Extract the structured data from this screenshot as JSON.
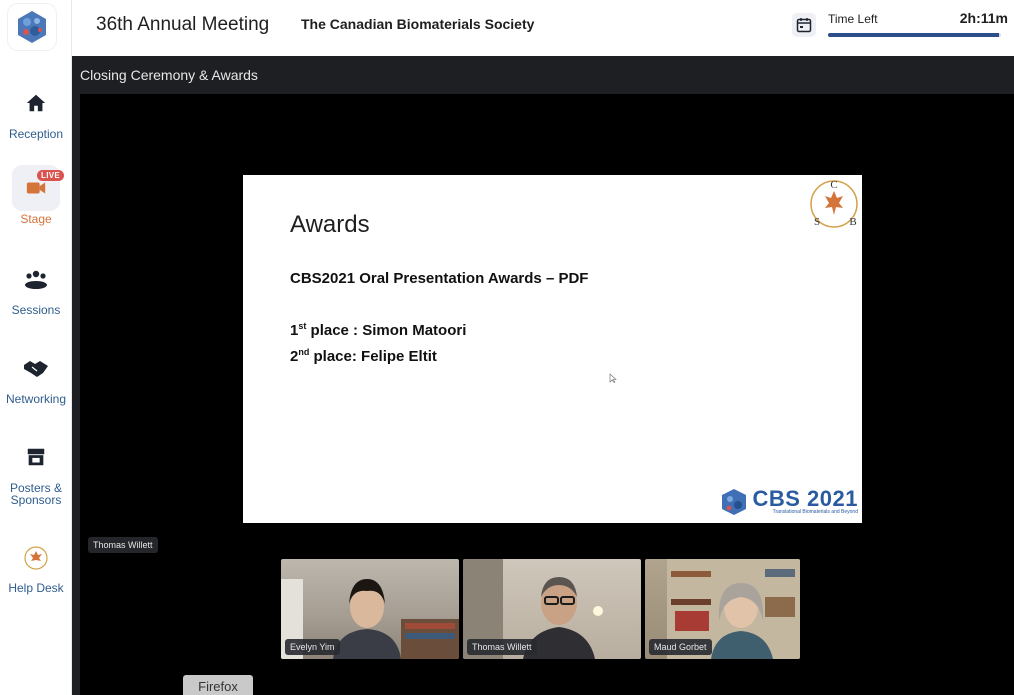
{
  "header": {
    "event_title": "36th Annual Meeting",
    "org_title": "The Canadian Biomaterials Society",
    "time_left_label": "Time Left",
    "time_left_value": "2h:11m",
    "time_left_progress": 0.99
  },
  "sidebar": {
    "items": [
      {
        "label": "Reception",
        "icon": "home-icon"
      },
      {
        "label": "Stage",
        "icon": "video-camera-icon",
        "badge": "LIVE",
        "active": true
      },
      {
        "label": "Sessions",
        "icon": "group-icon"
      },
      {
        "label": "Networking",
        "icon": "handshake-icon"
      },
      {
        "label": "Posters &\nSponsors",
        "icon": "storefront-icon"
      },
      {
        "label": "Help Desk",
        "icon": "csb-logo-icon"
      }
    ]
  },
  "stage": {
    "title": "Closing Ceremony & Awards",
    "speaker_label": "Thomas Willett"
  },
  "slide": {
    "title": "Awards",
    "subtitle": "CBS2021 Oral Presentation Awards – PDF",
    "first_sup": "st",
    "first_rest": " place : Simon Matoori",
    "second_sup": "nd",
    "second_rest": " place: Felipe Eltit",
    "logo_text": "CBS 2021",
    "logo_tagline": "Translational Biomaterials and Beyond",
    "csb_letters": [
      "C",
      "S",
      "B"
    ]
  },
  "participants": [
    {
      "name": "Evelyn Yim"
    },
    {
      "name": "Thomas Willett"
    },
    {
      "name": "Maud Gorbet"
    }
  ],
  "browser": {
    "tab_label": "Firefox"
  },
  "colors": {
    "accent": "#2f5d8e",
    "active": "#d4743a",
    "live": "#d9534f",
    "stage_bg": "#1d1f23",
    "cbs_blue": "#2a5aa0"
  }
}
